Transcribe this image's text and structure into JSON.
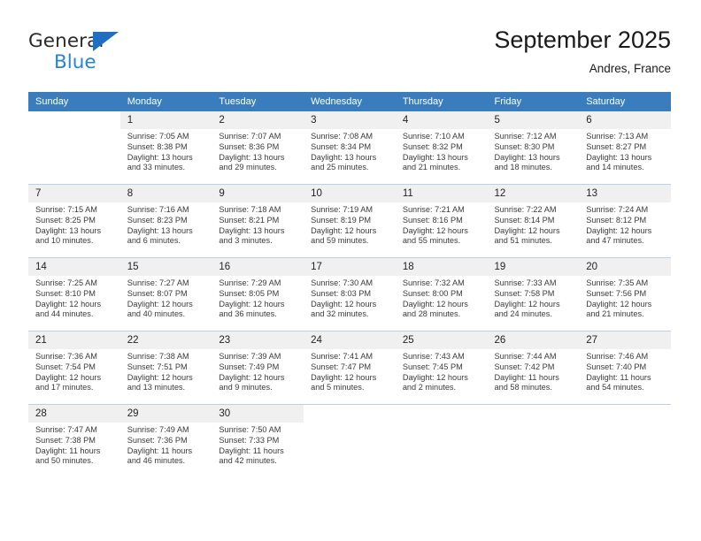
{
  "brand": {
    "name_top": "General",
    "name_bottom": "Blue",
    "accent_color": "#2484d8",
    "triangle_color": "#1f6fc4"
  },
  "header": {
    "title": "September 2025",
    "subtitle": "Andres, France"
  },
  "calendar": {
    "header_bg": "#3a7dbf",
    "daynum_bg": "#f0f0f0",
    "weekdays": [
      "Sunday",
      "Monday",
      "Tuesday",
      "Wednesday",
      "Thursday",
      "Friday",
      "Saturday"
    ],
    "weeks": [
      [
        {
          "day": "",
          "sunrise": "",
          "sunset": "",
          "daylight1": "",
          "daylight2": ""
        },
        {
          "day": "1",
          "sunrise": "Sunrise: 7:05 AM",
          "sunset": "Sunset: 8:38 PM",
          "daylight1": "Daylight: 13 hours",
          "daylight2": "and 33 minutes."
        },
        {
          "day": "2",
          "sunrise": "Sunrise: 7:07 AM",
          "sunset": "Sunset: 8:36 PM",
          "daylight1": "Daylight: 13 hours",
          "daylight2": "and 29 minutes."
        },
        {
          "day": "3",
          "sunrise": "Sunrise: 7:08 AM",
          "sunset": "Sunset: 8:34 PM",
          "daylight1": "Daylight: 13 hours",
          "daylight2": "and 25 minutes."
        },
        {
          "day": "4",
          "sunrise": "Sunrise: 7:10 AM",
          "sunset": "Sunset: 8:32 PM",
          "daylight1": "Daylight: 13 hours",
          "daylight2": "and 21 minutes."
        },
        {
          "day": "5",
          "sunrise": "Sunrise: 7:12 AM",
          "sunset": "Sunset: 8:30 PM",
          "daylight1": "Daylight: 13 hours",
          "daylight2": "and 18 minutes."
        },
        {
          "day": "6",
          "sunrise": "Sunrise: 7:13 AM",
          "sunset": "Sunset: 8:27 PM",
          "daylight1": "Daylight: 13 hours",
          "daylight2": "and 14 minutes."
        }
      ],
      [
        {
          "day": "7",
          "sunrise": "Sunrise: 7:15 AM",
          "sunset": "Sunset: 8:25 PM",
          "daylight1": "Daylight: 13 hours",
          "daylight2": "and 10 minutes."
        },
        {
          "day": "8",
          "sunrise": "Sunrise: 7:16 AM",
          "sunset": "Sunset: 8:23 PM",
          "daylight1": "Daylight: 13 hours",
          "daylight2": "and 6 minutes."
        },
        {
          "day": "9",
          "sunrise": "Sunrise: 7:18 AM",
          "sunset": "Sunset: 8:21 PM",
          "daylight1": "Daylight: 13 hours",
          "daylight2": "and 3 minutes."
        },
        {
          "day": "10",
          "sunrise": "Sunrise: 7:19 AM",
          "sunset": "Sunset: 8:19 PM",
          "daylight1": "Daylight: 12 hours",
          "daylight2": "and 59 minutes."
        },
        {
          "day": "11",
          "sunrise": "Sunrise: 7:21 AM",
          "sunset": "Sunset: 8:16 PM",
          "daylight1": "Daylight: 12 hours",
          "daylight2": "and 55 minutes."
        },
        {
          "day": "12",
          "sunrise": "Sunrise: 7:22 AM",
          "sunset": "Sunset: 8:14 PM",
          "daylight1": "Daylight: 12 hours",
          "daylight2": "and 51 minutes."
        },
        {
          "day": "13",
          "sunrise": "Sunrise: 7:24 AM",
          "sunset": "Sunset: 8:12 PM",
          "daylight1": "Daylight: 12 hours",
          "daylight2": "and 47 minutes."
        }
      ],
      [
        {
          "day": "14",
          "sunrise": "Sunrise: 7:25 AM",
          "sunset": "Sunset: 8:10 PM",
          "daylight1": "Daylight: 12 hours",
          "daylight2": "and 44 minutes."
        },
        {
          "day": "15",
          "sunrise": "Sunrise: 7:27 AM",
          "sunset": "Sunset: 8:07 PM",
          "daylight1": "Daylight: 12 hours",
          "daylight2": "and 40 minutes."
        },
        {
          "day": "16",
          "sunrise": "Sunrise: 7:29 AM",
          "sunset": "Sunset: 8:05 PM",
          "daylight1": "Daylight: 12 hours",
          "daylight2": "and 36 minutes."
        },
        {
          "day": "17",
          "sunrise": "Sunrise: 7:30 AM",
          "sunset": "Sunset: 8:03 PM",
          "daylight1": "Daylight: 12 hours",
          "daylight2": "and 32 minutes."
        },
        {
          "day": "18",
          "sunrise": "Sunrise: 7:32 AM",
          "sunset": "Sunset: 8:00 PM",
          "daylight1": "Daylight: 12 hours",
          "daylight2": "and 28 minutes."
        },
        {
          "day": "19",
          "sunrise": "Sunrise: 7:33 AM",
          "sunset": "Sunset: 7:58 PM",
          "daylight1": "Daylight: 12 hours",
          "daylight2": "and 24 minutes."
        },
        {
          "day": "20",
          "sunrise": "Sunrise: 7:35 AM",
          "sunset": "Sunset: 7:56 PM",
          "daylight1": "Daylight: 12 hours",
          "daylight2": "and 21 minutes."
        }
      ],
      [
        {
          "day": "21",
          "sunrise": "Sunrise: 7:36 AM",
          "sunset": "Sunset: 7:54 PM",
          "daylight1": "Daylight: 12 hours",
          "daylight2": "and 17 minutes."
        },
        {
          "day": "22",
          "sunrise": "Sunrise: 7:38 AM",
          "sunset": "Sunset: 7:51 PM",
          "daylight1": "Daylight: 12 hours",
          "daylight2": "and 13 minutes."
        },
        {
          "day": "23",
          "sunrise": "Sunrise: 7:39 AM",
          "sunset": "Sunset: 7:49 PM",
          "daylight1": "Daylight: 12 hours",
          "daylight2": "and 9 minutes."
        },
        {
          "day": "24",
          "sunrise": "Sunrise: 7:41 AM",
          "sunset": "Sunset: 7:47 PM",
          "daylight1": "Daylight: 12 hours",
          "daylight2": "and 5 minutes."
        },
        {
          "day": "25",
          "sunrise": "Sunrise: 7:43 AM",
          "sunset": "Sunset: 7:45 PM",
          "daylight1": "Daylight: 12 hours",
          "daylight2": "and 2 minutes."
        },
        {
          "day": "26",
          "sunrise": "Sunrise: 7:44 AM",
          "sunset": "Sunset: 7:42 PM",
          "daylight1": "Daylight: 11 hours",
          "daylight2": "and 58 minutes."
        },
        {
          "day": "27",
          "sunrise": "Sunrise: 7:46 AM",
          "sunset": "Sunset: 7:40 PM",
          "daylight1": "Daylight: 11 hours",
          "daylight2": "and 54 minutes."
        }
      ],
      [
        {
          "day": "28",
          "sunrise": "Sunrise: 7:47 AM",
          "sunset": "Sunset: 7:38 PM",
          "daylight1": "Daylight: 11 hours",
          "daylight2": "and 50 minutes."
        },
        {
          "day": "29",
          "sunrise": "Sunrise: 7:49 AM",
          "sunset": "Sunset: 7:36 PM",
          "daylight1": "Daylight: 11 hours",
          "daylight2": "and 46 minutes."
        },
        {
          "day": "30",
          "sunrise": "Sunrise: 7:50 AM",
          "sunset": "Sunset: 7:33 PM",
          "daylight1": "Daylight: 11 hours",
          "daylight2": "and 42 minutes."
        },
        {
          "day": "",
          "sunrise": "",
          "sunset": "",
          "daylight1": "",
          "daylight2": ""
        },
        {
          "day": "",
          "sunrise": "",
          "sunset": "",
          "daylight1": "",
          "daylight2": ""
        },
        {
          "day": "",
          "sunrise": "",
          "sunset": "",
          "daylight1": "",
          "daylight2": ""
        },
        {
          "day": "",
          "sunrise": "",
          "sunset": "",
          "daylight1": "",
          "daylight2": ""
        }
      ]
    ]
  }
}
